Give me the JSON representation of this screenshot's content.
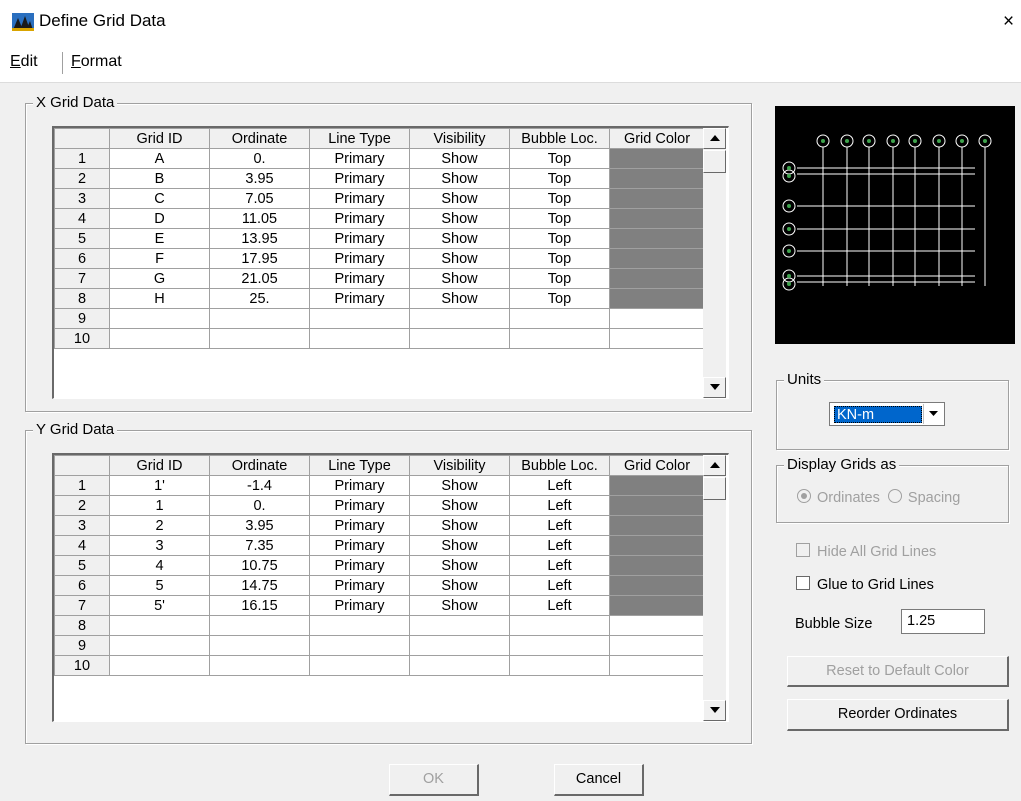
{
  "window": {
    "title": "Define Grid Data",
    "close_glyph": "×"
  },
  "menu": {
    "edit": {
      "accel": "E",
      "rest": "dit"
    },
    "format": {
      "accel": "F",
      "rest": "ormat"
    }
  },
  "colors": {
    "grid_color_fill": "#808080",
    "preview_background": "#000000",
    "preview_lines": "#ffffff",
    "units_highlight": "#0066cc"
  },
  "x_grid": {
    "label": "X Grid Data",
    "columns": [
      "Grid ID",
      "Ordinate",
      "Line Type",
      "Visibility",
      "Bubble Loc.",
      "Grid Color"
    ],
    "rows": [
      {
        "n": "1",
        "id": "A",
        "ord": "0.",
        "type": "Primary",
        "vis": "Show",
        "bub": "Top"
      },
      {
        "n": "2",
        "id": "B",
        "ord": "3.95",
        "type": "Primary",
        "vis": "Show",
        "bub": "Top"
      },
      {
        "n": "3",
        "id": "C",
        "ord": "7.05",
        "type": "Primary",
        "vis": "Show",
        "bub": "Top"
      },
      {
        "n": "4",
        "id": "D",
        "ord": "11.05",
        "type": "Primary",
        "vis": "Show",
        "bub": "Top"
      },
      {
        "n": "5",
        "id": "E",
        "ord": "13.95",
        "type": "Primary",
        "vis": "Show",
        "bub": "Top"
      },
      {
        "n": "6",
        "id": "F",
        "ord": "17.95",
        "type": "Primary",
        "vis": "Show",
        "bub": "Top"
      },
      {
        "n": "7",
        "id": "G",
        "ord": "21.05",
        "type": "Primary",
        "vis": "Show",
        "bub": "Top"
      },
      {
        "n": "8",
        "id": "H",
        "ord": "25.",
        "type": "Primary",
        "vis": "Show",
        "bub": "Top"
      },
      {
        "n": "9",
        "id": "",
        "ord": "",
        "type": "",
        "vis": "",
        "bub": ""
      },
      {
        "n": "10",
        "id": "",
        "ord": "",
        "type": "",
        "vis": "",
        "bub": ""
      }
    ]
  },
  "y_grid": {
    "label": "Y Grid Data",
    "columns": [
      "Grid ID",
      "Ordinate",
      "Line Type",
      "Visibility",
      "Bubble Loc.",
      "Grid Color"
    ],
    "rows": [
      {
        "n": "1",
        "id": "1'",
        "ord": "-1.4",
        "type": "Primary",
        "vis": "Show",
        "bub": "Left"
      },
      {
        "n": "2",
        "id": "1",
        "ord": "0.",
        "type": "Primary",
        "vis": "Show",
        "bub": "Left"
      },
      {
        "n": "3",
        "id": "2",
        "ord": "3.95",
        "type": "Primary",
        "vis": "Show",
        "bub": "Left"
      },
      {
        "n": "4",
        "id": "3",
        "ord": "7.35",
        "type": "Primary",
        "vis": "Show",
        "bub": "Left"
      },
      {
        "n": "5",
        "id": "4",
        "ord": "10.75",
        "type": "Primary",
        "vis": "Show",
        "bub": "Left"
      },
      {
        "n": "6",
        "id": "5",
        "ord": "14.75",
        "type": "Primary",
        "vis": "Show",
        "bub": "Left"
      },
      {
        "n": "7",
        "id": "5'",
        "ord": "16.15",
        "type": "Primary",
        "vis": "Show",
        "bub": "Left"
      },
      {
        "n": "8",
        "id": "",
        "ord": "",
        "type": "",
        "vis": "",
        "bub": ""
      },
      {
        "n": "9",
        "id": "",
        "ord": "",
        "type": "",
        "vis": "",
        "bub": ""
      },
      {
        "n": "10",
        "id": "",
        "ord": "",
        "type": "",
        "vis": "",
        "bub": ""
      }
    ]
  },
  "units": {
    "label": "Units",
    "value": "KN-m"
  },
  "display_grids": {
    "label": "Display Grids as",
    "ordinates": "Ordinates",
    "spacing": "Spacing",
    "selected": "Ordinates"
  },
  "hide_all_grid_lines": {
    "label": "Hide All Grid Lines",
    "checked": false
  },
  "glue_to_grid_lines": {
    "label": "Glue to Grid Lines",
    "checked": false
  },
  "bubble_size": {
    "label": "Bubble Size",
    "value": "1.25"
  },
  "buttons": {
    "reset_color": "Reset to Default Color",
    "reorder": "Reorder Ordinates",
    "ok": "OK",
    "cancel": "Cancel"
  }
}
